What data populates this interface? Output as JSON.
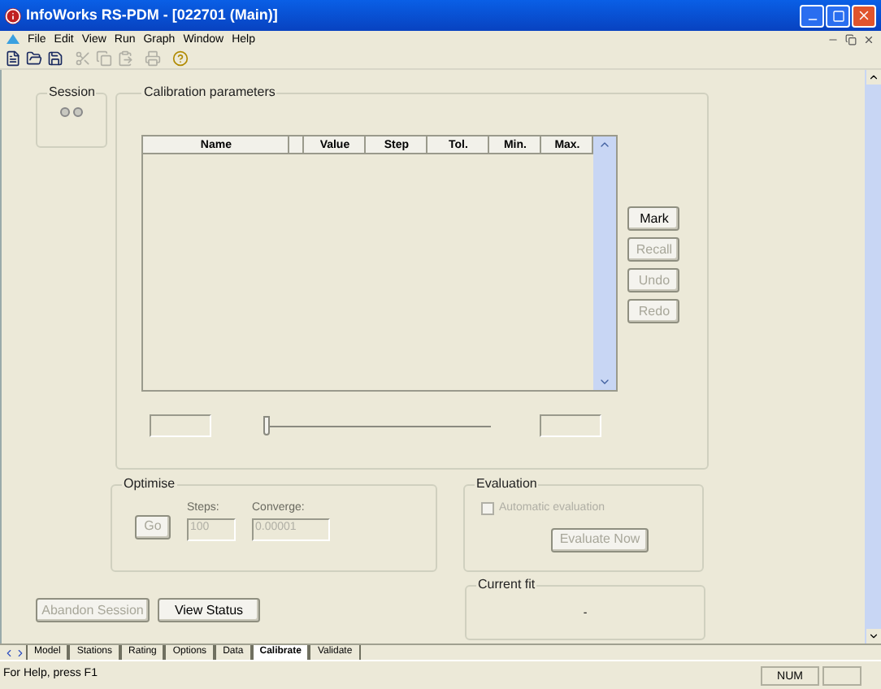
{
  "window": {
    "title": "InfoWorks RS-PDM - [022701 (Main)]"
  },
  "menu": [
    "File",
    "Edit",
    "View",
    "Run",
    "Graph",
    "Window",
    "Help"
  ],
  "toolbar": [
    {
      "kind": "new",
      "disabled": false
    },
    {
      "kind": "open",
      "disabled": false
    },
    {
      "kind": "save",
      "disabled": false
    },
    {
      "kind": "cut",
      "disabled": true
    },
    {
      "kind": "copy",
      "disabled": true
    },
    {
      "kind": "paste",
      "disabled": true
    },
    {
      "kind": "print",
      "disabled": true
    },
    {
      "kind": "help",
      "disabled": false
    }
  ],
  "session": {
    "title": "Session"
  },
  "calibration": {
    "title": "Calibration parameters",
    "columns": [
      "Name",
      "Value",
      "Step",
      "Tol.",
      "Min.",
      "Max."
    ],
    "buttons": [
      {
        "label": "Mark",
        "disabled": false
      },
      {
        "label": "Recall",
        "disabled": true
      },
      {
        "label": "Undo",
        "disabled": true
      },
      {
        "label": "Redo",
        "disabled": true
      }
    ],
    "slider": {
      "level": 0
    }
  },
  "optimise": {
    "title": "Optimise",
    "go": {
      "label": "Go",
      "disabled": true
    },
    "fields": [
      {
        "label": "Steps:",
        "value": "100",
        "disabled": true
      },
      {
        "label": "Converge:",
        "value": "0.00001",
        "disabled": true
      }
    ]
  },
  "evaluation": {
    "title": "Evaluation",
    "automatic": {
      "label": "Automatic evaluation",
      "checked": false,
      "disabled": true
    },
    "evaluate_now": {
      "label": "Evaluate Now",
      "disabled": true
    }
  },
  "current_fit": {
    "title": "Current fit",
    "value": "-"
  },
  "actions": [
    {
      "label": "Abandon Session",
      "disabled": true
    },
    {
      "label": "View Status",
      "disabled": false
    }
  ],
  "tabs": [
    {
      "label": "Model",
      "selected": false
    },
    {
      "label": "Stations",
      "selected": false
    },
    {
      "label": "Rating",
      "selected": false
    },
    {
      "label": "Options",
      "selected": false
    },
    {
      "label": "Data",
      "selected": false
    },
    {
      "label": "Calibrate",
      "selected": true
    },
    {
      "label": "Validate",
      "selected": false
    }
  ],
  "status_bar": {
    "message": "For Help, press F1",
    "indicators": [
      "NUM"
    ]
  }
}
